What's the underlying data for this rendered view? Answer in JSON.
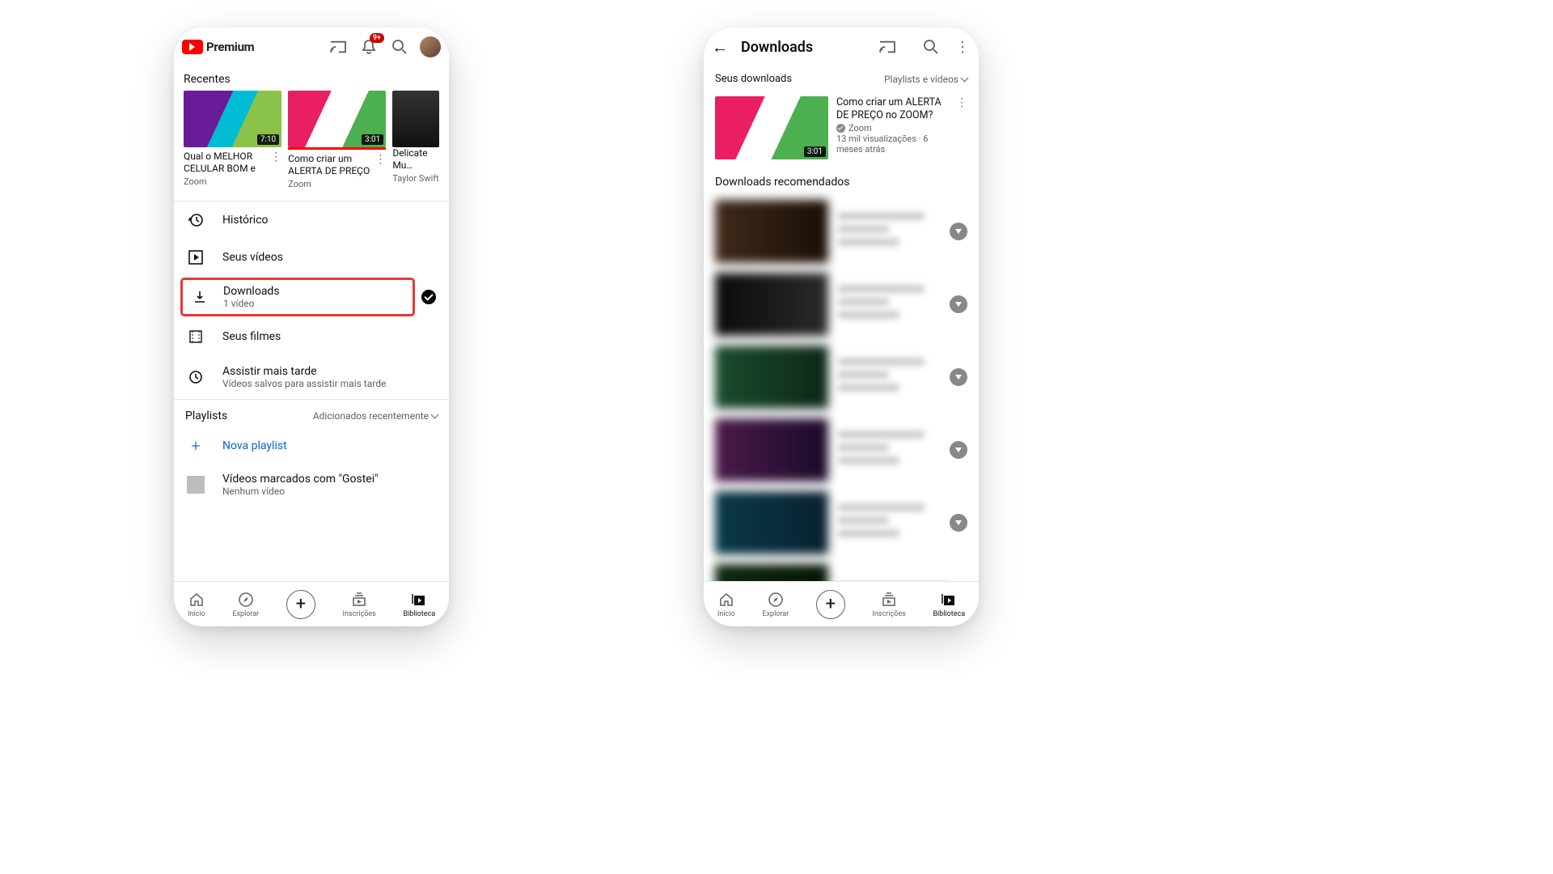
{
  "left": {
    "header": {
      "logo_text": "Premium",
      "notif_badge": "9+"
    },
    "recents_label": "Recentes",
    "recents": [
      {
        "title": "Qual o MELHOR CELULAR BOM e B…",
        "channel": "Zoom",
        "duration": "7:10"
      },
      {
        "title": "Como criar um ALERTA DE PREÇO …",
        "channel": "Zoom",
        "duration": "3:01"
      },
      {
        "title": "Delicate Mu… Dance Rehe…",
        "channel": "Taylor Swift",
        "duration": ""
      }
    ],
    "menu": {
      "history": "Histórico",
      "your_videos": "Seus vídeos",
      "downloads": {
        "title": "Downloads",
        "sub": "1 vídeo"
      },
      "movies": "Seus filmes",
      "watch_later": {
        "title": "Assistir mais tarde",
        "sub": "Vídeos salvos para assistir mais tarde"
      }
    },
    "playlists": {
      "label": "Playlists",
      "sort": "Adicionados recentemente",
      "new": "Nova playlist",
      "liked": {
        "title": "Vídeos marcados com \"Gostei\"",
        "sub": "Nenhum vídeo"
      }
    }
  },
  "right": {
    "title": "Downloads",
    "your_dl": "Seus downloads",
    "filter": "Playlists e vídeos",
    "item": {
      "title": "Como criar um ALERTA DE PREÇO no ZOOM?",
      "channel": "Zoom",
      "stats": "13 mil visualizações · 6 meses atrás",
      "duration": "3:01"
    },
    "recommended": "Downloads recomendados"
  },
  "nav": {
    "home": "Início",
    "explore": "Explorar",
    "subs": "Inscrições",
    "library": "Biblioteca"
  }
}
